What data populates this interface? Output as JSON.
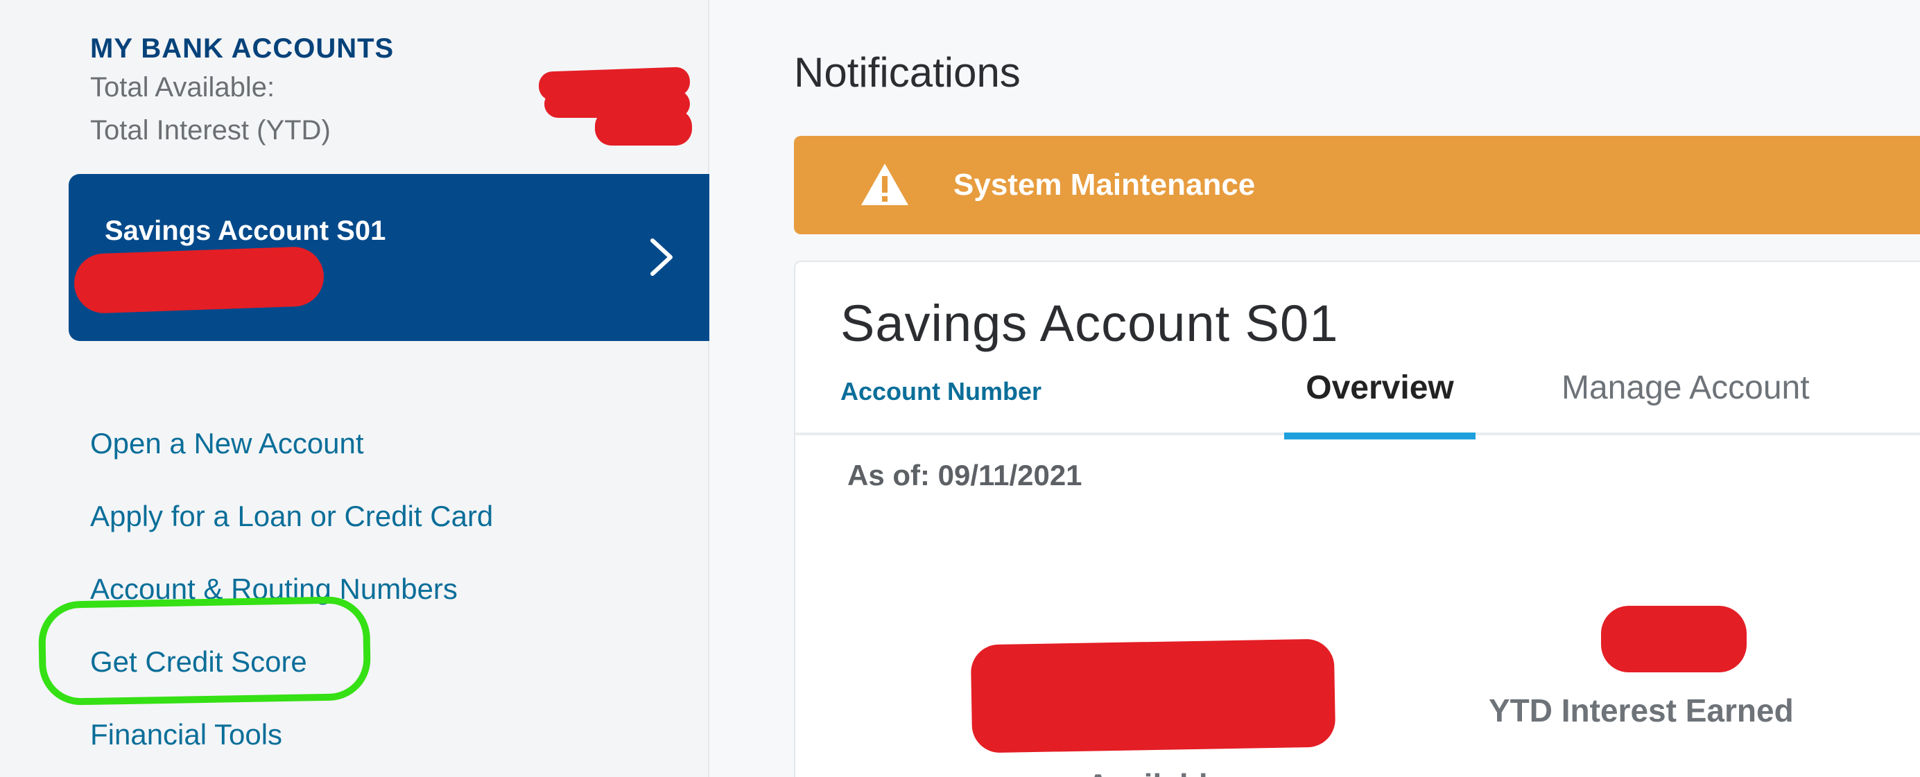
{
  "sidebar": {
    "heading": "MY BANK ACCOUNTS",
    "total_available_label": "Total Available:",
    "total_interest_label": "Total Interest (YTD)",
    "account_card": {
      "name": "Savings Account S01",
      "chevron_icon": "chevron-right-icon"
    },
    "links": [
      "Open a New Account",
      "Apply for a Loan or Credit Card",
      "Account & Routing Numbers",
      "Get Credit Score",
      "Financial Tools"
    ]
  },
  "main": {
    "notifications_title": "Notifications",
    "banner": {
      "icon": "warning-icon",
      "text": "System Maintenance"
    },
    "account_panel": {
      "title": "Savings Account S01",
      "account_number_link": "Account Number",
      "tabs": [
        {
          "label": "Overview",
          "active": true
        },
        {
          "label": "Manage Account",
          "active": false
        }
      ],
      "as_of": "As of: 09/11/2021",
      "ytd_label": "YTD Interest Earned",
      "available_label": "Available"
    }
  },
  "colors": {
    "brand_blue": "#044a8b",
    "link_teal": "#0a6e99",
    "banner_orange": "#e79c3e",
    "tab_active": "#1ea0dd",
    "redaction_red": "#e41e25",
    "highlight_green": "#35e014"
  }
}
